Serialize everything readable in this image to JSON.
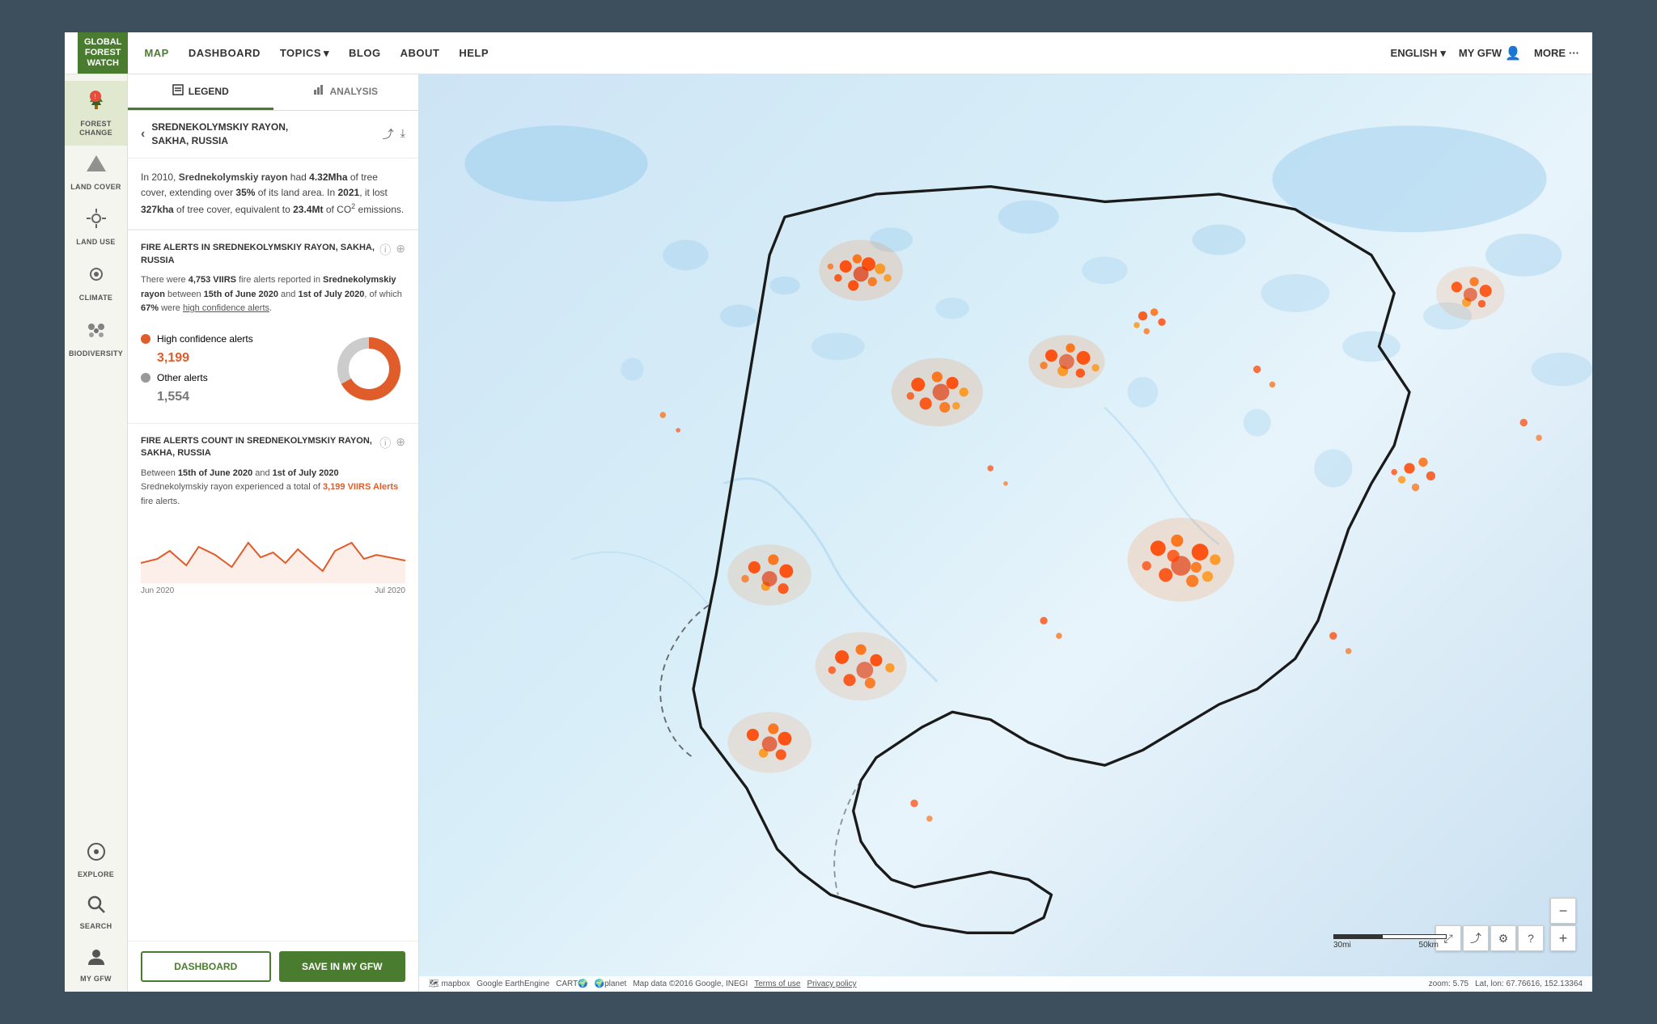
{
  "logo": {
    "line1": "GLOBAL",
    "line2": "FOREST",
    "line3": "WATCH"
  },
  "nav": {
    "links": [
      {
        "label": "MAP",
        "key": "map",
        "active": true,
        "dropdown": false
      },
      {
        "label": "DASHBOARD",
        "key": "dashboard",
        "active": false,
        "dropdown": false
      },
      {
        "label": "TOPICS",
        "key": "topics",
        "active": false,
        "dropdown": true
      },
      {
        "label": "BLOG",
        "key": "blog",
        "active": false,
        "dropdown": false
      },
      {
        "label": "ABOUT",
        "key": "about",
        "active": false,
        "dropdown": false
      },
      {
        "label": "HELP",
        "key": "help",
        "active": false,
        "dropdown": false
      }
    ],
    "right": [
      {
        "label": "ENGLISH",
        "dropdown": true
      },
      {
        "label": "MY GFW",
        "user": true
      },
      {
        "label": "MORE",
        "ellipsis": true
      }
    ]
  },
  "sidebar": {
    "items": [
      {
        "label": "FOREST CHANGE",
        "icon": "🌲",
        "key": "forest-change",
        "active": true,
        "notification": true
      },
      {
        "label": "LAND COVER",
        "icon": "▲",
        "key": "land-cover",
        "active": false
      },
      {
        "label": "LAND USE",
        "icon": "✦",
        "key": "land-use",
        "active": false
      },
      {
        "label": "CLIMATE",
        "icon": "⊙",
        "key": "climate",
        "active": false
      },
      {
        "label": "BIODIVERSITY",
        "icon": "🐾",
        "key": "biodiversity",
        "active": false
      }
    ],
    "bottom_items": [
      {
        "label": "EXPLORE",
        "icon": "⊙",
        "key": "explore"
      },
      {
        "label": "SEARCH",
        "icon": "🔍",
        "key": "search"
      },
      {
        "label": "MY GFW",
        "icon": "👤",
        "key": "my-gfw"
      }
    ]
  },
  "panel": {
    "tabs": [
      {
        "label": "LEGEND",
        "icon": "📋",
        "active": true,
        "key": "legend"
      },
      {
        "label": "ANALYSIS",
        "icon": "📊",
        "active": false,
        "key": "analysis"
      }
    ],
    "region": {
      "name": "SREDNEKOLYMSKIY RAYON,",
      "name2": "SAKHA, RUSSIA"
    },
    "summary": {
      "text_parts": [
        {
          "text": "In 2010, "
        },
        {
          "text": "Srednekolymskiy rayon",
          "bold": true
        },
        {
          "text": " had "
        },
        {
          "text": "4.32Mha",
          "bold": true
        },
        {
          "text": " of tree cover, extending over "
        },
        {
          "text": "35%",
          "bold": true
        },
        {
          "text": " of its land area. In "
        },
        {
          "text": "2021",
          "bold": true
        },
        {
          "text": ", it lost "
        },
        {
          "text": "327kha",
          "bold": true
        },
        {
          "text": " of tree cover, equivalent to "
        },
        {
          "text": "23.4Mt",
          "bold": true
        },
        {
          "text": " of CO₂ emissions."
        }
      ],
      "text": "In 2010, Srednekolymskiy rayon had 4.32Mha of tree cover, extending over 35% of its land area. In 2021, it lost 327kha of tree cover, equivalent to 23.4Mt of CO₂ emissions."
    },
    "fire_widget": {
      "title": "FIRE ALERTS IN SREDNEKOLYMSKIY RAYON, SAKHA, RUSSIA",
      "description": "There were 4,753 VIIRS fire alerts reported in Srednekolymskiy rayon between 15th of June 2020 and 1st of July 2020, of which 67% were high confidence alerts.",
      "high_confidence": {
        "label": "High confidence alerts",
        "value": "3,199",
        "color": "#e05c2a"
      },
      "other": {
        "label": "Other alerts",
        "value": "1,554",
        "color": "#999"
      },
      "donut": {
        "high_pct": 67,
        "other_pct": 33
      }
    },
    "count_widget": {
      "title": "FIRE ALERTS COUNT IN SREDNEKOLYMSKIY RAYON, SAKHA, RUSSIA",
      "description": "Between 15th of June 2020 and 1st of July 2020 Srednekolymskiy rayon experienced a total of 3,199 VIIRS Alerts fire alerts.",
      "timeline": {
        "start_label": "Jun 2020",
        "end_label": "Jul 2020"
      }
    },
    "footer": {
      "dashboard_label": "DASHBOARD",
      "save_label": "SAVE IN MY GFW"
    }
  },
  "map": {
    "attribution": "mapbox  Google EarthEngine  CART🌍  🌍planet  Map data ©2016 Google, INEGI",
    "terms": "Terms of use",
    "privacy": "Privacy policy",
    "zoom": "zoom: 5.75",
    "coordinates": "Lat, lon: 67.76616, 152.13364",
    "scale": {
      "mi": "30mi",
      "km": "50km"
    }
  },
  "colors": {
    "brand_green": "#4a7c2f",
    "fire_red": "#e05c2a",
    "fire_orange": "#ff8c00",
    "map_water": "#a8d4f0",
    "map_bg": "#e8f0e8"
  }
}
